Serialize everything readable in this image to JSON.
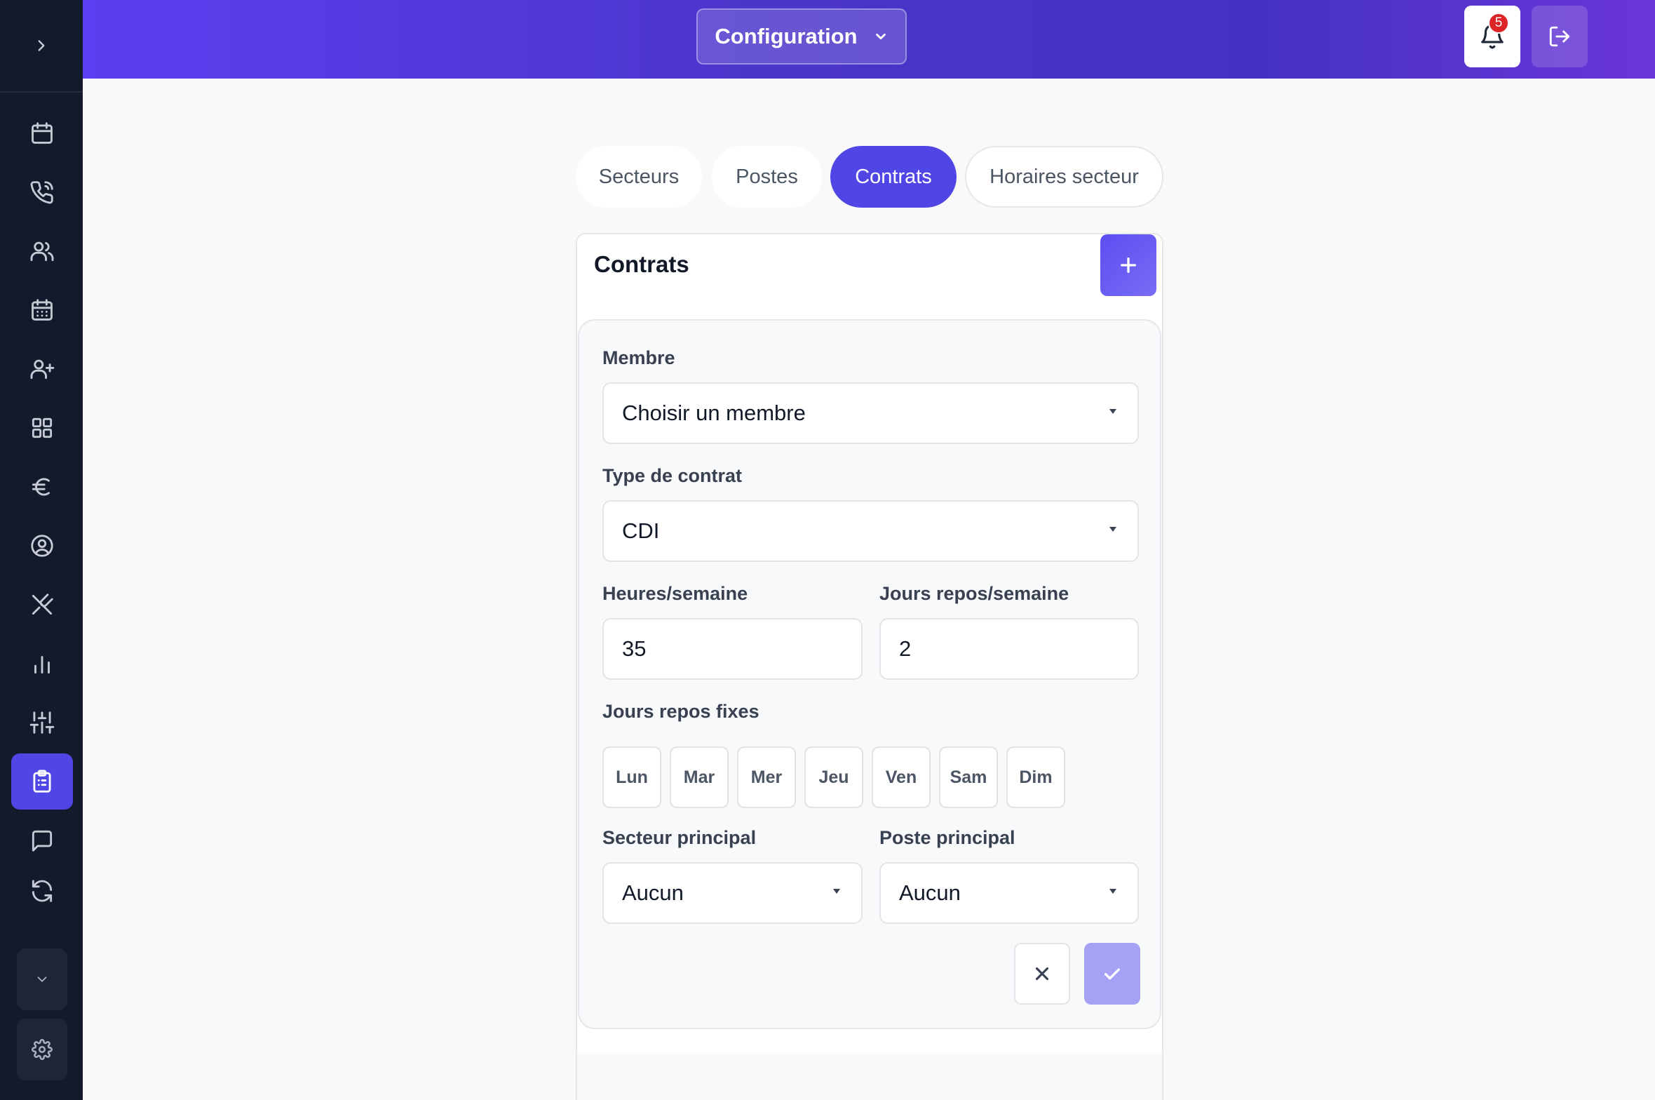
{
  "header": {
    "config_label": "Configuration",
    "notification_count": "5",
    "icons": {
      "dropdown": "chevron-down-icon",
      "bell": "bell-icon",
      "logout": "logout-icon"
    },
    "colors": {
      "gradient_start": "#5b3ff0",
      "gradient_end": "#6a35d8"
    }
  },
  "sidebar": {
    "items": [
      {
        "icon": "calendar-icon",
        "active": false
      },
      {
        "icon": "phone-icon",
        "active": false
      },
      {
        "icon": "users-icon",
        "active": false
      },
      {
        "icon": "calendar-grid-icon",
        "active": false
      },
      {
        "icon": "user-plus-icon",
        "active": false
      },
      {
        "icon": "grid-icon",
        "active": false
      },
      {
        "icon": "euro-icon",
        "active": false
      },
      {
        "icon": "user-circle-icon",
        "active": false
      },
      {
        "icon": "utensils-cross-icon",
        "active": false
      },
      {
        "icon": "bar-chart-icon",
        "active": false
      },
      {
        "icon": "sliders-icon",
        "active": false
      },
      {
        "icon": "clipboard-list-icon",
        "active": true
      },
      {
        "icon": "message-icon",
        "active": false
      },
      {
        "icon": "refresh-icon",
        "active": false
      }
    ],
    "accent_color": "#4f46e5"
  },
  "tabs": [
    {
      "label": "Secteurs",
      "active": false
    },
    {
      "label": "Postes",
      "active": false
    },
    {
      "label": "Contrats",
      "active": true
    },
    {
      "label": "Horaires secteur",
      "active": false
    }
  ],
  "card": {
    "title": "Contrats",
    "form": {
      "member_label": "Membre",
      "member_value": "Choisir un membre",
      "contract_type_label": "Type de contrat",
      "contract_type_value": "CDI",
      "hours_label": "Heures/semaine",
      "hours_value": "35",
      "rest_days_label": "Jours repos/semaine",
      "rest_days_value": "2",
      "fixed_rest_label": "Jours repos fixes",
      "days": [
        "Lun",
        "Mar",
        "Mer",
        "Jeu",
        "Ven",
        "Sam",
        "Dim"
      ],
      "sector_label": "Secteur principal",
      "sector_value": "Aucun",
      "post_label": "Poste principal",
      "post_value": "Aucun"
    }
  }
}
